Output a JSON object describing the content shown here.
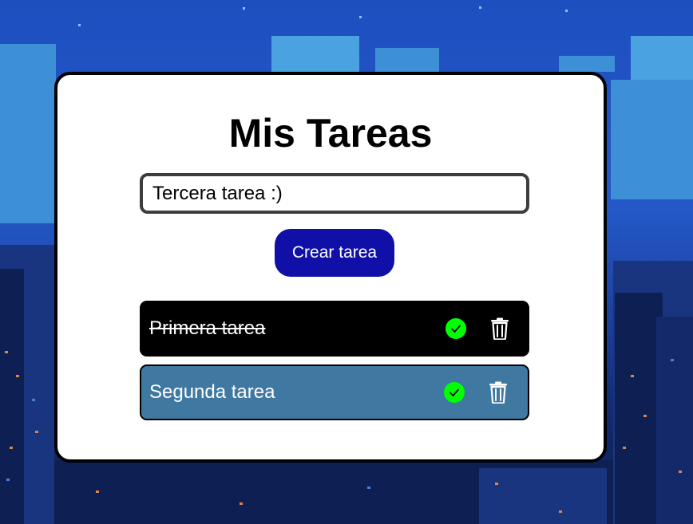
{
  "app": {
    "title": "Mis Tareas"
  },
  "form": {
    "input_value": "Tercera tarea :)",
    "input_placeholder": "",
    "create_label": "Crear tarea"
  },
  "tasks": [
    {
      "label": "Primera tarea",
      "completed": true,
      "theme": "#000000"
    },
    {
      "label": "Segunda tarea",
      "completed": false,
      "theme": "#3f78a1"
    }
  ],
  "icons": {
    "complete": "check-circle-icon",
    "delete": "trash-icon"
  },
  "colors": {
    "accent": "#1010a8",
    "check": "#00ff00",
    "card": "#ffffff"
  }
}
